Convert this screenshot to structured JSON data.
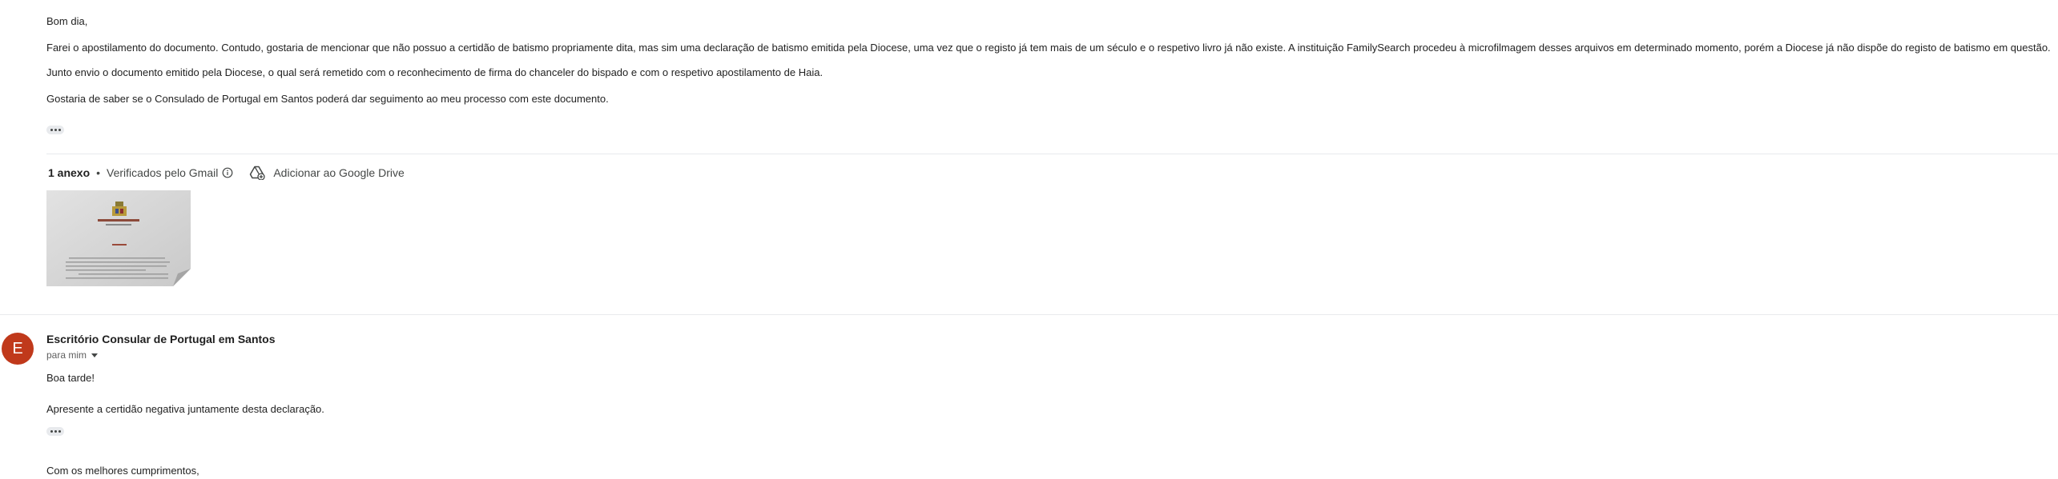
{
  "message1": {
    "paragraphs": [
      "Bom dia,",
      "Farei o apostilamento do documento. Contudo, gostaria de mencionar que não possuo a certidão de batismo propriamente dita, mas sim uma declaração de batismo emitida pela Diocese, uma vez que o registo já tem mais de um século e o respetivo livro já não existe. A instituição FamilySearch procedeu à microfilmagem desses arquivos em determinado momento, porém a Diocese já não dispõe do registo de batismo em questão.",
      "Junto envio o documento emitido pela Diocese, o qual será remetido com o reconhecimento de firma do chanceler do bispado e com o respetivo apostilamento de Haia.",
      "Gostaria de saber se o Consulado de Portugal em Santos poderá dar seguimento ao meu processo com este documento."
    ],
    "attachments": {
      "count_label": "1 anexo",
      "separator": "•",
      "scanned_label": "Verificados pelo Gmail",
      "drive_label": "Adicionar ao Google Drive",
      "info_icon": "info-icon",
      "drive_icon": "add-to-drive-icon"
    }
  },
  "message2": {
    "avatar_letter": "E",
    "avatar_color": "#c0391b",
    "sender": "Escritório Consular de Portugal em Santos",
    "recipient": "para mim",
    "paragraphs": [
      "Boa tarde!",
      "Apresente a certidão negativa juntamente desta declaração.",
      "Com os melhores cumprimentos,"
    ]
  }
}
